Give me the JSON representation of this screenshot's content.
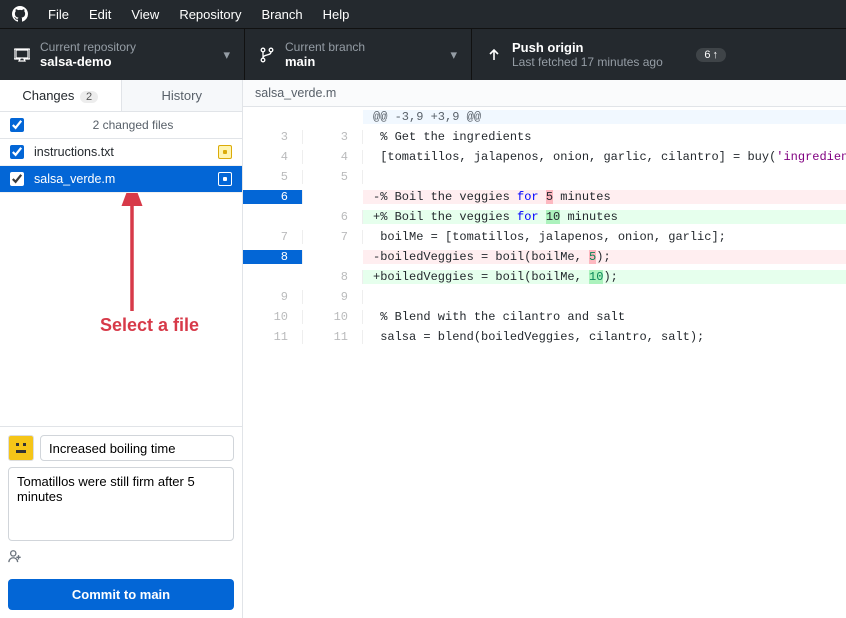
{
  "menu": [
    "File",
    "Edit",
    "View",
    "Repository",
    "Branch",
    "Help"
  ],
  "toolbar": {
    "repo": {
      "label": "Current repository",
      "value": "salsa-demo"
    },
    "branch": {
      "label": "Current branch",
      "value": "main"
    },
    "push": {
      "label": "Push origin",
      "sub": "Last fetched 17 minutes ago",
      "badge_count": "6",
      "badge_arrow": "↑"
    }
  },
  "tabs": {
    "changes": {
      "label": "Changes",
      "count": "2",
      "active": true
    },
    "history": {
      "label": "History",
      "active": false
    }
  },
  "files_header": "2 changed files",
  "files": [
    {
      "name": "instructions.txt",
      "selected": false,
      "status": "modified"
    },
    {
      "name": "salsa_verde.m",
      "selected": true,
      "status": "modified"
    }
  ],
  "annotation": "Select a file",
  "commit": {
    "summary": "Increased boiling time",
    "description": "Tomatillos were still firm after 5 minutes",
    "button_prefix": "Commit to ",
    "button_branch": "main"
  },
  "diff": {
    "filename": "salsa_verde.m",
    "hunk_header": "@@ -3,9 +3,9 @@",
    "rows": [
      {
        "type": "hunk",
        "old": "",
        "new": ""
      },
      {
        "type": "ctx",
        "old": "3",
        "new": "3",
        "text": " % Get the ingredients",
        "cls": "cm"
      },
      {
        "type": "ctx",
        "old": "4",
        "new": "4",
        "html": " [tomatillos, jalapenos, onion, garlic, cilantro] = buy(<span class='cm'>'ingredients.txt'</span>);"
      },
      {
        "type": "ctx",
        "old": "5",
        "new": "5",
        "text": " "
      },
      {
        "type": "removed",
        "old": "6",
        "new": "",
        "oldblue": true,
        "html": "-% Boil the veggies <span class='kw'>for</span> <span class='hi-del'>5</span> minutes",
        "cls": "cm"
      },
      {
        "type": "added",
        "old": "",
        "new": "6",
        "html": "+% Boil the veggies <span class='kw'>for</span> <span class='hi-add'>10</span> minutes",
        "cls": "cm"
      },
      {
        "type": "ctx",
        "old": "7",
        "new": "7",
        "html": " boilMe = [tomatillos, jalapenos, onion, garlic];"
      },
      {
        "type": "removed",
        "old": "8",
        "new": "",
        "oldblue": true,
        "html": "-boiledVeggies = boil(boilMe, <span class='hi-del'><span class='num'>5</span></span>);"
      },
      {
        "type": "added",
        "old": "",
        "new": "8",
        "html": "+boiledVeggies = boil(boilMe, <span class='hi-add'><span class='num'>10</span></span>);"
      },
      {
        "type": "ctx",
        "old": "9",
        "new": "9",
        "text": " "
      },
      {
        "type": "ctx",
        "old": "10",
        "new": "10",
        "text": " % Blend with the cilantro and salt",
        "cls": "cm"
      },
      {
        "type": "ctx",
        "old": "11",
        "new": "11",
        "html": " salsa = blend(boiledVeggies, cilantro, salt);"
      }
    ]
  }
}
